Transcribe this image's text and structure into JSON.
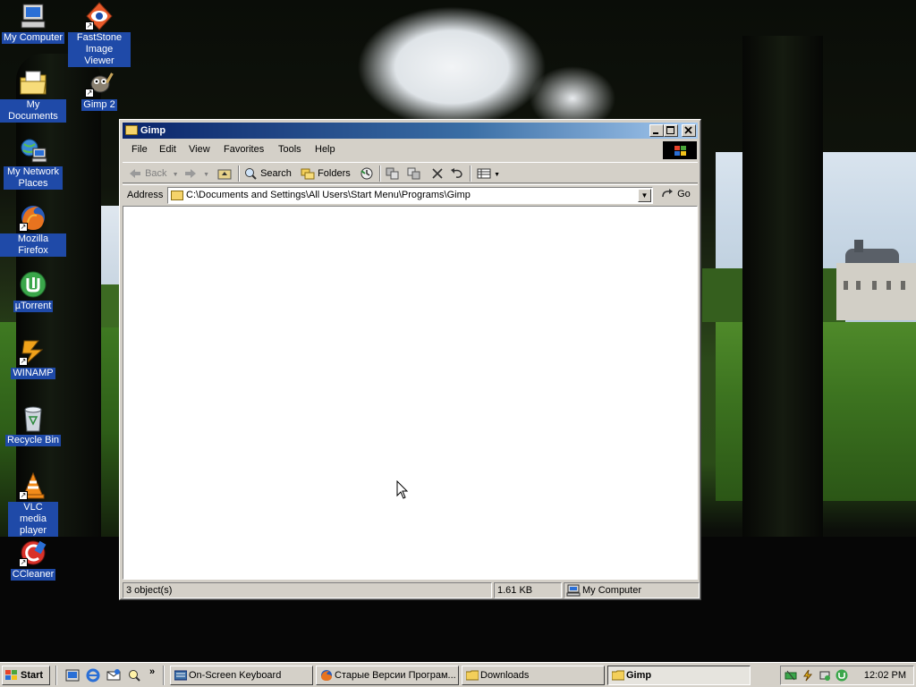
{
  "desktop": {
    "icons": [
      {
        "label": "My Computer",
        "icon": "my-computer-icon"
      },
      {
        "label": "FastStone Image Viewer",
        "icon": "faststone-icon"
      },
      {
        "label": "My Documents",
        "icon": "my-documents-icon"
      },
      {
        "label": "Gimp 2",
        "icon": "gimp-icon"
      },
      {
        "label": "My Network Places",
        "icon": "network-places-icon"
      },
      {
        "label": "Mozilla Firefox",
        "icon": "firefox-icon"
      },
      {
        "label": "µTorrent",
        "icon": "utorrent-icon"
      },
      {
        "label": "WINAMP",
        "icon": "winamp-icon"
      },
      {
        "label": "Recycle Bin",
        "icon": "recycle-bin-icon"
      },
      {
        "label": "VLC media player",
        "icon": "vlc-icon"
      },
      {
        "label": "CCleaner",
        "icon": "ccleaner-icon"
      }
    ]
  },
  "window": {
    "title": "Gimp",
    "menu": [
      "File",
      "Edit",
      "View",
      "Favorites",
      "Tools",
      "Help"
    ],
    "toolbar": {
      "back": "Back",
      "search": "Search",
      "folders": "Folders"
    },
    "address": {
      "label": "Address",
      "value": "C:\\Documents and Settings\\All Users\\Start Menu\\Programs\\Gimp",
      "go": "Go"
    },
    "status": {
      "objects": "3 object(s)",
      "size": "1.61 KB",
      "zone": "My Computer"
    }
  },
  "taskbar": {
    "start": "Start",
    "tasks": [
      {
        "label": "On-Screen Keyboard",
        "active": false
      },
      {
        "label": "Старые Версии Програм...",
        "active": false
      },
      {
        "label": "Downloads",
        "active": false
      },
      {
        "label": "Gimp",
        "active": true
      }
    ],
    "clock": "12:02 PM"
  },
  "colors": {
    "title_active": "#0a246a",
    "title_gradient_end": "#a6caf0",
    "face": "#d4d0c8",
    "desktop_label_bg": "#1f4aa8"
  }
}
